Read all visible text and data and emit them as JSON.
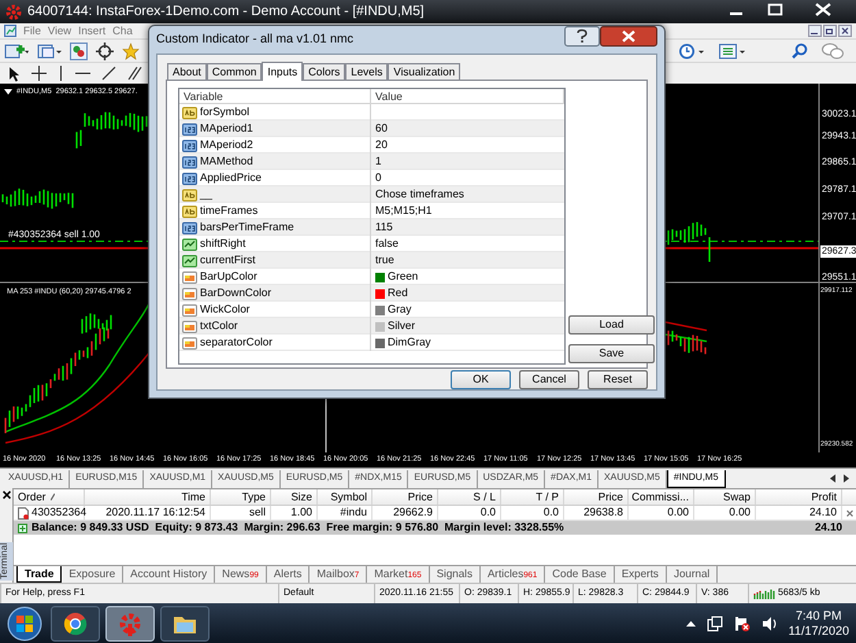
{
  "window": {
    "title": "64007144: InstaForex-1Demo.com - Demo Account - [#INDU,M5]"
  },
  "menu": [
    "File",
    "View",
    "Insert",
    "Cha"
  ],
  "chart": {
    "header": "#INDU,M5  29632.1 29632.5 29627.",
    "order_line": "#430352364 sell 1.00",
    "indicator_header": "MA 253 #INDU (60,20) 29745.4796 2",
    "price_labels": [
      "30023.1",
      "29943.1",
      "29865.1",
      "29787.1",
      "29707.1",
      "29627.3",
      "29551.1"
    ],
    "indicator_labels": [
      "29917.112",
      "29230.582"
    ],
    "time_labels": [
      "16 Nov 2020",
      "16 Nov 13:25",
      "16 Nov 14:45",
      "16 Nov 16:05",
      "16 Nov 17:25",
      "16 Nov 18:45",
      "16 Nov 20:05",
      "16 Nov 21:25",
      "16 Nov 22:45",
      "17 Nov 11:05",
      "17 Nov 12:25",
      "17 Nov 13:45",
      "17 Nov 15:05",
      "17 Nov 16:25"
    ]
  },
  "chart_tabs": [
    {
      "label": "XAUUSD,H1",
      "selected": false
    },
    {
      "label": "EURUSD,M15",
      "selected": false
    },
    {
      "label": "XAUUSD,M1",
      "selected": false
    },
    {
      "label": "XAUUSD,M5",
      "selected": false
    },
    {
      "label": "EURUSD,M5",
      "selected": false
    },
    {
      "label": "#NDX,M15",
      "selected": false
    },
    {
      "label": "EURUSD,M5",
      "selected": false
    },
    {
      "label": "USDZAR,M5",
      "selected": false
    },
    {
      "label": "#DAX,M1",
      "selected": false
    },
    {
      "label": "XAUUSD,M5",
      "selected": false
    },
    {
      "label": "#INDU,M5",
      "selected": true
    }
  ],
  "dialog": {
    "title": "Custom Indicator - all ma v1.01 nmc",
    "tabs": [
      {
        "label": "About",
        "selected": false
      },
      {
        "label": "Common",
        "selected": false
      },
      {
        "label": "Inputs",
        "selected": true
      },
      {
        "label": "Colors",
        "selected": false
      },
      {
        "label": "Levels",
        "selected": false
      },
      {
        "label": "Visualization",
        "selected": false
      }
    ],
    "columns": [
      "Variable",
      "Value"
    ],
    "rows": [
      {
        "kind": "string",
        "variable": "forSymbol"
      },
      {
        "kind": "int",
        "variable": "MAperiod1",
        "value": "60"
      },
      {
        "kind": "int",
        "variable": "MAperiod2",
        "value": "20"
      },
      {
        "kind": "int",
        "variable": "MAMethod",
        "value": "1"
      },
      {
        "kind": "int",
        "variable": "AppliedPrice",
        "value": "0"
      },
      {
        "kind": "string",
        "variable": "__",
        "value": "Chose timeframes"
      },
      {
        "kind": "string",
        "variable": "timeFrames",
        "value": "M5;M15;H1"
      },
      {
        "kind": "int",
        "variable": "barsPerTimeFrame",
        "value": "115"
      },
      {
        "kind": "bool",
        "variable": "shiftRight",
        "value": "false"
      },
      {
        "kind": "bool",
        "variable": "currentFirst",
        "value": "true"
      },
      {
        "kind": "color",
        "variable": "BarUpColor",
        "value": "Green",
        "color": "#008000"
      },
      {
        "kind": "color",
        "variable": "BarDownColor",
        "value": "Red",
        "color": "#ff0000"
      },
      {
        "kind": "color",
        "variable": "WickColor",
        "value": "Gray",
        "color": "#808080"
      },
      {
        "kind": "color",
        "variable": "txtColor",
        "value": "Silver",
        "color": "#c0c0c0"
      },
      {
        "kind": "color",
        "variable": "separatorColor",
        "value": "DimGray",
        "color": "#696969"
      }
    ],
    "side_buttons": [
      "Load",
      "Save"
    ],
    "buttons": [
      "OK",
      "Cancel",
      "Reset"
    ]
  },
  "terminal": {
    "side_label": "Terminal",
    "columns": [
      "Order",
      "Time",
      "Type",
      "Size",
      "Symbol",
      "Price",
      "S / L",
      "T / P",
      "Price",
      "Commissi...",
      "Swap",
      "Profit"
    ],
    "orders": [
      {
        "cells": [
          "430352364",
          "2020.11.17 16:12:54",
          "sell",
          "1.00",
          "#indu",
          "29662.9",
          "0.0",
          "0.0",
          "29638.8",
          "0.00",
          "0.00",
          "24.10"
        ]
      }
    ],
    "balance": "Balance: 9 849.33 USD  Equity: 9 873.43  Margin: 296.63  Free margin: 9 576.80  Margin level: 3328.55%",
    "balance_profit": "24.10",
    "tabs": [
      {
        "label": "Trade",
        "selected": true
      },
      {
        "label": "Exposure",
        "selected": false
      },
      {
        "label": "Account History",
        "selected": false
      },
      {
        "label": "News",
        "badge": "99",
        "selected": false
      },
      {
        "label": "Alerts",
        "selected": false
      },
      {
        "label": "Mailbox",
        "badge": "7",
        "selected": false
      },
      {
        "label": "Market",
        "badge": "165",
        "selected": false
      },
      {
        "label": "Signals",
        "selected": false
      },
      {
        "label": "Articles",
        "badge": "961",
        "selected": false
      },
      {
        "label": "Code Base",
        "selected": false
      },
      {
        "label": "Experts",
        "selected": false
      },
      {
        "label": "Journal",
        "selected": false
      }
    ]
  },
  "status_bar": [
    "For Help, press F1",
    "Default",
    "2020.11.16 21:55",
    "O: 29839.1",
    "H: 29855.9",
    "L: 29828.3",
    "C: 29844.9",
    "V: 386",
    "5683/5 kb"
  ],
  "taskbar": {
    "time": "7:40 PM",
    "date": "11/17/2020"
  }
}
